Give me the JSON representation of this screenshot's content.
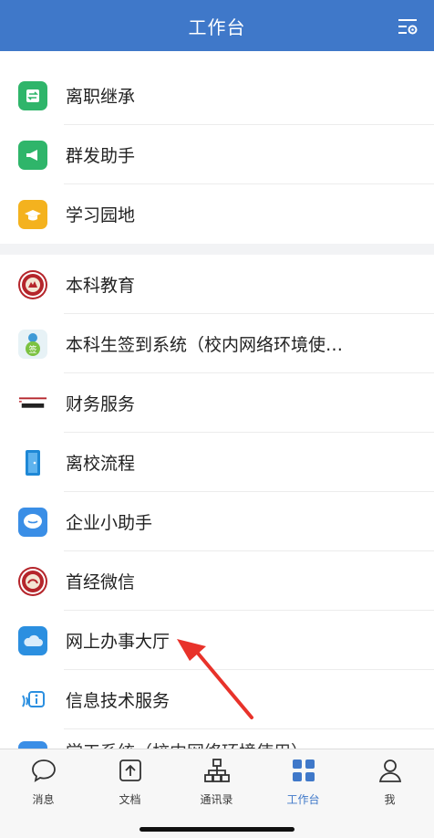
{
  "header": {
    "title": "工作台",
    "settings_icon": "settings-sliders-icon"
  },
  "colors": {
    "header_bg": "#3f78c9",
    "active_tab": "#3f78c9",
    "arrow": "#e8322a"
  },
  "apps_group1": [
    {
      "label": "离职继承",
      "icon": "transfer-icon",
      "color": "#2fb56a"
    },
    {
      "label": "群发助手",
      "icon": "megaphone-icon",
      "color": "#2fb56a"
    },
    {
      "label": "学习园地",
      "icon": "graduation-cap-icon",
      "color": "#f4b21e"
    }
  ],
  "apps_group2": [
    {
      "label": "本科教育",
      "icon": "university-seal-icon"
    },
    {
      "label": "本科生签到系统（校内网络环境使…",
      "icon": "sign-in-mascot-icon"
    },
    {
      "label": "财务服务",
      "icon": "finance-office-logo-icon"
    },
    {
      "label": "离校流程",
      "icon": "door-exit-icon"
    },
    {
      "label": "企业小助手",
      "icon": "chat-bubble-icon"
    },
    {
      "label": "首经微信",
      "icon": "university-seal-icon"
    },
    {
      "label": "网上办事大厅",
      "icon": "cloud-icon"
    },
    {
      "label": "信息技术服务",
      "icon": "info-signal-icon"
    },
    {
      "label": "学工系统（校内网络环境使用）",
      "icon": "document-icon"
    }
  ],
  "tabs": [
    {
      "label": "消息",
      "icon": "message-bubble-icon",
      "active": false
    },
    {
      "label": "文档",
      "icon": "document-tab-icon",
      "active": false
    },
    {
      "label": "通讯录",
      "icon": "org-chart-icon",
      "active": false
    },
    {
      "label": "工作台",
      "icon": "grid-icon",
      "active": true
    },
    {
      "label": "我",
      "icon": "person-icon",
      "active": false
    }
  ]
}
